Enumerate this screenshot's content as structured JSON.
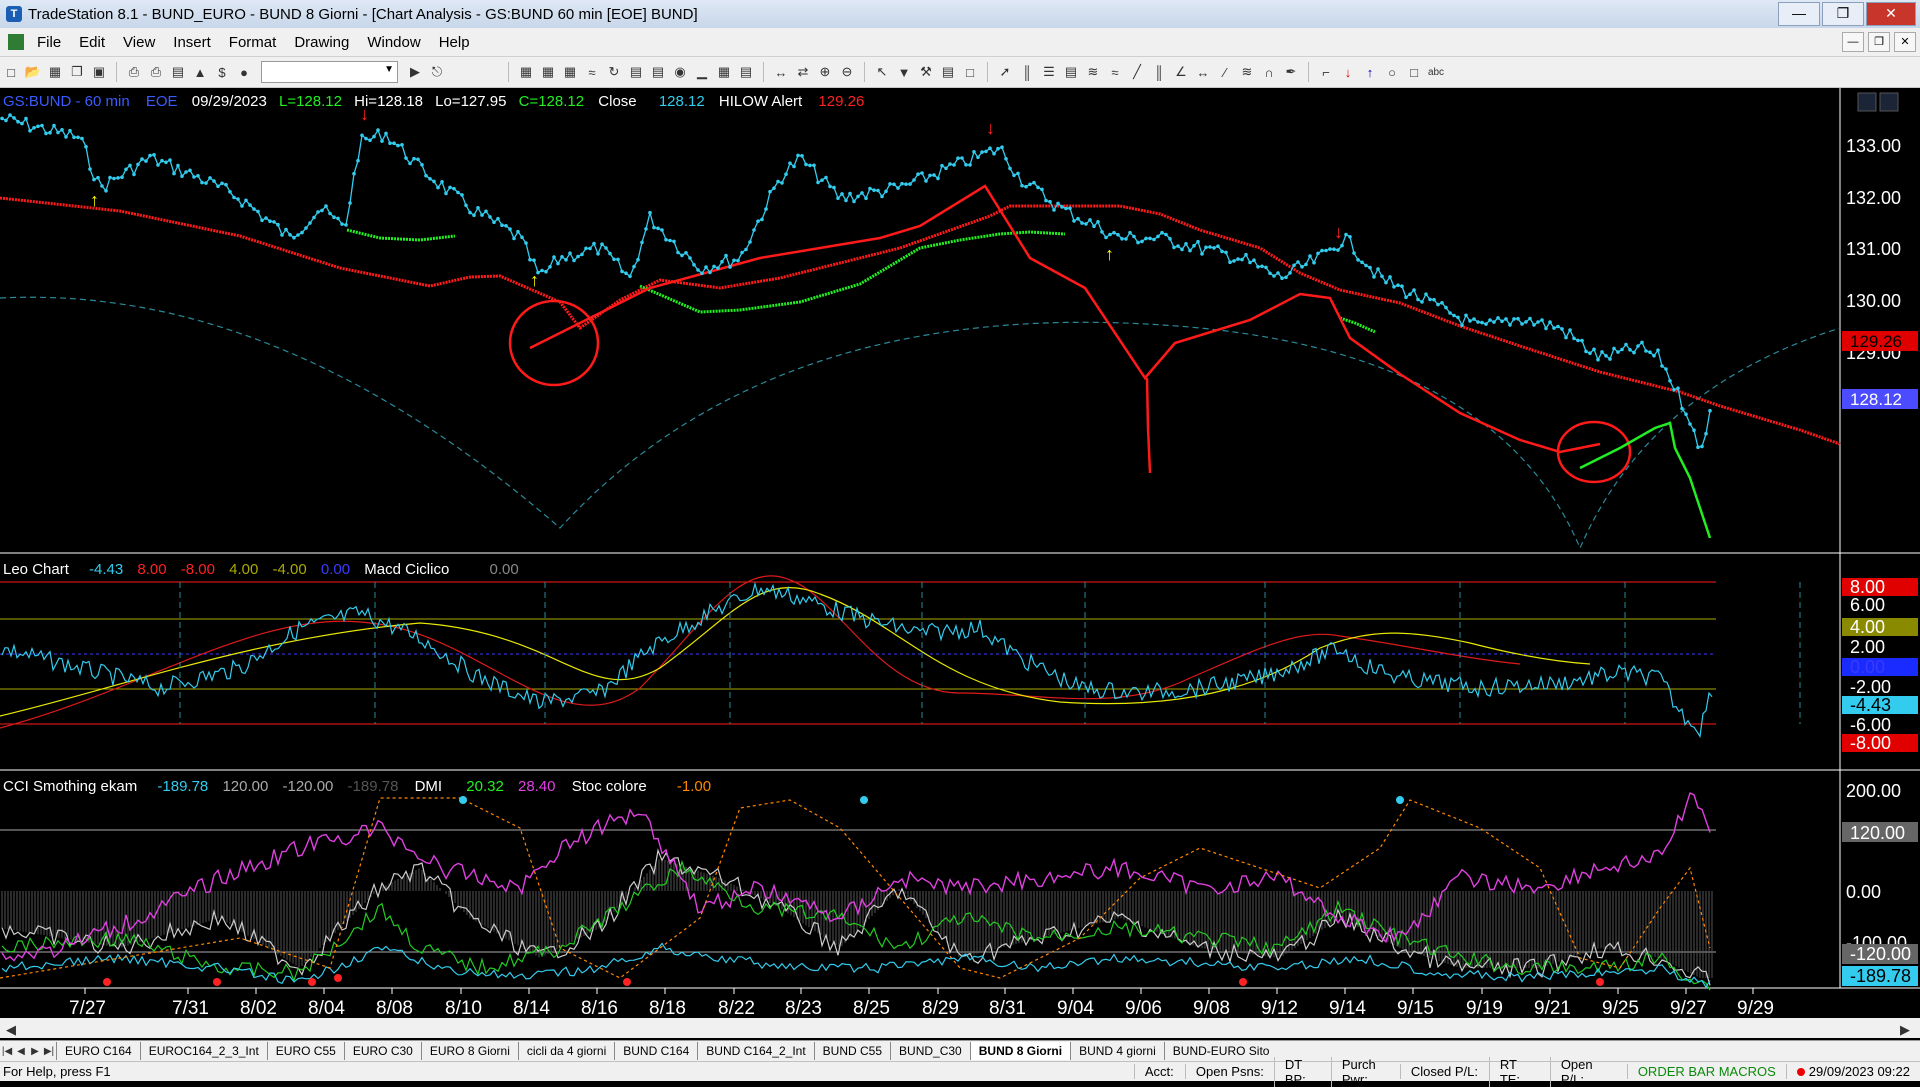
{
  "window": {
    "title": "TradeStation 8.1 - BUND_EURO - BUND 8 Giorni - [Chart Analysis - GS:BUND  60 min  [EOE] BUND]"
  },
  "menu": [
    "File",
    "Edit",
    "View",
    "Insert",
    "Format",
    "Drawing",
    "Window",
    "Help"
  ],
  "status_line": {
    "symbol": "GS:BUND - 60 min",
    "feed": "EOE",
    "date": "09/29/2023",
    "last": "L=128.12",
    "high": "Hi=128.18",
    "low": "Lo=127.95",
    "close": "C=128.12",
    "close_label": "Close",
    "close_val": "128.12",
    "indicator": "HILOW Alert",
    "indicator_val": "129.26"
  },
  "panel2_header": {
    "name": "Leo Chart",
    "v1": "-4.43",
    "v2": "8.00",
    "v3": "-8.00",
    "v4": "4.00",
    "v5": "-4.00",
    "v6": "0.00",
    "name2": "Macd Ciclico",
    "v7": "0.00"
  },
  "panel3_header": {
    "name": "CCI Smothing ekam",
    "v1": "-189.78",
    "v2": "120.00",
    "v3": "-120.00",
    "v4": "-189.78",
    "name2": "DMI",
    "v5": "20.32",
    "v6": "28.40",
    "name3": "Stoc colore",
    "v7": "-1.00"
  },
  "price_axis": [
    "133.00",
    "132.00",
    "131.00",
    "130.00",
    "129.00"
  ],
  "price_markers": {
    "red": "129.26",
    "blue": "128.12"
  },
  "leo_axis": [
    "8.00",
    "6.00",
    "4.00",
    "2.00",
    "0.00",
    "-2.00",
    "-4.43",
    "-6.00",
    "-8.00"
  ],
  "cci_axis": [
    "200.00",
    "120.00",
    "0.00",
    "-100.00",
    "-120.00",
    "-189.78"
  ],
  "date_axis": [
    "7/27",
    "7/31",
    "8/02",
    "8/04",
    "8/08",
    "8/10",
    "8/14",
    "8/16",
    "8/18",
    "8/22",
    "8/23",
    "8/25",
    "8/29",
    "8/31",
    "9/04",
    "9/06",
    "9/08",
    "9/12",
    "9/14",
    "9/15",
    "9/19",
    "9/21",
    "9/25",
    "9/27",
    "9/29"
  ],
  "colors": {
    "price": "#33ccee",
    "ma_red": "#ff1a1a",
    "ma_green": "#22ee22",
    "yellow": "#e8e800",
    "magenta": "#e040e0",
    "blue": "#1a2bff"
  },
  "workspace_tabs": [
    "EURO C164",
    "EUROC164_2_3_Int",
    "EURO C55",
    "EURO C30",
    "EURO 8 Giorni",
    "cicli da 4 giorni",
    "BUND C164",
    "BUND C164_2_Int",
    "BUND C55",
    "BUND_C30",
    "BUND 8 Giorni",
    "BUND 4 giorni",
    "BUND-EURO Sito"
  ],
  "active_tab": "BUND 8 Giorni",
  "statusbar": {
    "help": "For Help, press F1",
    "acct": "Acct:",
    "open_psns": "Open Psns:",
    "dt_bp": "DT BP:",
    "purch_pwr": "Purch Pwr:",
    "closed_pl": "Closed P/L:",
    "rt_te": "RT TE:",
    "open_pl": "Open P/L:",
    "order_bar": "ORDER BAR  MACROS",
    "datetime": "29/09/2023 09:22"
  }
}
